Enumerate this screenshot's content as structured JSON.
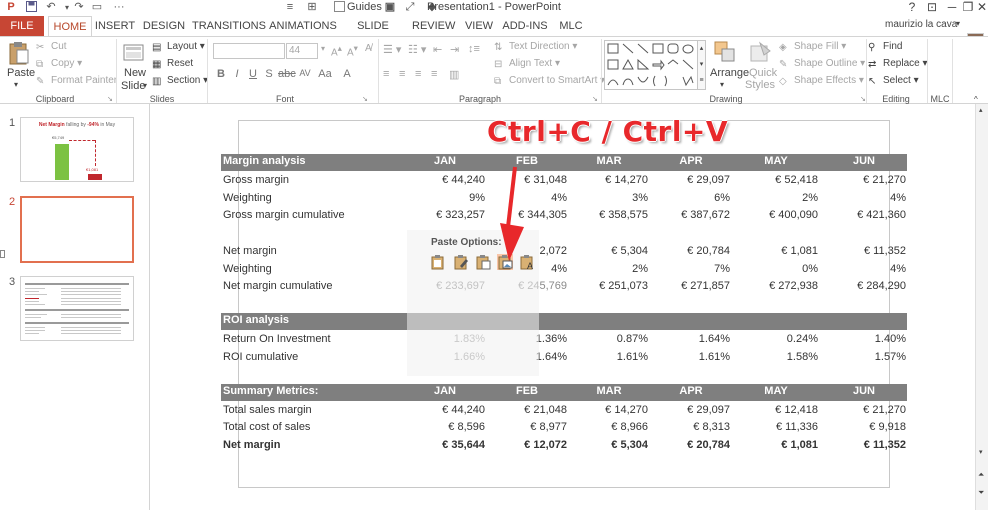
{
  "window": {
    "title": "Presentation1 - PowerPoint",
    "guides_label": "Guides",
    "user_name": "maurizio la cava",
    "help": "?",
    "ribbon_opts": "⊡",
    "minimize": "─",
    "restore": "❐",
    "close": "✕"
  },
  "tabs": [
    "FILE",
    "HOME",
    "INSERT",
    "DESIGN",
    "TRANSITIONS",
    "ANIMATIONS",
    "SLIDE SHOW",
    "REVIEW",
    "VIEW",
    "ADD-INS",
    "MLC"
  ],
  "ribbon": {
    "clipboard": {
      "paste": "Paste",
      "cut": "Cut",
      "copy": "Copy",
      "format_painter": "Format Painter",
      "label": "Clipboard"
    },
    "slides": {
      "new_slide_1": "New",
      "new_slide_2": "Slide",
      "layout": "Layout",
      "reset": "Reset",
      "section": "Section",
      "label": "Slides"
    },
    "font": {
      "size": "44",
      "label": "Font"
    },
    "paragraph": {
      "text_direction": "Text Direction",
      "align_text": "Align Text",
      "convert_smartart": "Convert to SmartArt",
      "label": "Paragraph"
    },
    "drawing": {
      "arrange": "Arrange",
      "quick_styles_1": "Quick",
      "quick_styles_2": "Styles",
      "shape_fill": "Shape Fill",
      "shape_outline": "Shape Outline",
      "shape_effects": "Shape Effects",
      "label": "Drawing"
    },
    "editing": {
      "find": "Find",
      "replace": "Replace",
      "select": "Select",
      "label": "Editing"
    },
    "mlc": {
      "label": "MLC"
    }
  },
  "thumbnails": {
    "numbers": [
      "1",
      "2",
      "3"
    ],
    "slide1_title_a": "Net Margin",
    "slide1_title_b": " falling by ",
    "slide1_title_c": "-94%",
    "slide1_title_d": " in May",
    "slide1_bar1_label": "€5,749",
    "slide1_bar2_label": "€1,081"
  },
  "slide": {
    "overlay_title": "Ctrl+C / Ctrl+V",
    "months": [
      "JAN",
      "FEB",
      "MAR",
      "APR",
      "MAY",
      "JUN"
    ],
    "margin_header": "Margin analysis",
    "margin_rows": [
      {
        "label": "Gross margin",
        "values": [
          "€ 44,240",
          "€ 31,048",
          "€ 14,270",
          "€ 29,097",
          "€ 52,418",
          "€ 21,270"
        ]
      },
      {
        "label": "Weighting",
        "values": [
          "9%",
          "4%",
          "3%",
          "6%",
          "2%",
          "4%"
        ]
      },
      {
        "label": "Gross margin cumulative",
        "values": [
          "€ 323,257",
          "€ 344,305",
          "€ 358,575",
          "€ 387,672",
          "€ 400,090",
          "€ 421,360"
        ]
      }
    ],
    "net_rows": [
      {
        "label": "Net margin",
        "values": [
          "",
          "2,072",
          "€ 5,304",
          "€ 20,784",
          "€ 1,081",
          "€ 11,352"
        ]
      },
      {
        "label": "Weighting",
        "values": [
          "",
          "4%",
          "2%",
          "7%",
          "0%",
          "4%"
        ]
      },
      {
        "label": "Net margin cumulative",
        "values": [
          "€ 233,697",
          "€ 245,769",
          "€ 251,073",
          "€ 271,857",
          "€ 272,938",
          "€ 284,290"
        ]
      }
    ],
    "roi_header": "ROI analysis",
    "roi_rows": [
      {
        "label": "Return On Investment",
        "values": [
          "1.83%",
          "1.36%",
          "0.87%",
          "1.64%",
          "0.24%",
          "1.40%"
        ]
      },
      {
        "label": "ROI cumulative",
        "values": [
          "1.66%",
          "1.64%",
          "1.61%",
          "1.61%",
          "1.58%",
          "1.57%"
        ]
      }
    ],
    "summary_header": "Summary Metrics:",
    "summary_rows": [
      {
        "label": "Total sales margin",
        "values": [
          "€ 44,240",
          "€ 21,048",
          "€ 14,270",
          "€ 29,097",
          "€ 12,418",
          "€ 21,270"
        ]
      },
      {
        "label": "Total cost of sales",
        "values": [
          "€ 8,596",
          "€ 8,977",
          "€ 8,966",
          "€ 8,313",
          "€ 11,336",
          "€ 9,918"
        ]
      },
      {
        "label": "Net margin",
        "values": [
          "€ 35,644",
          "€ 12,072",
          "€ 5,304",
          "€ 20,784",
          "€ 1,081",
          "€ 11,352"
        ]
      }
    ],
    "paste_options_label": "Paste Options:"
  },
  "colors": {
    "accent": "#c74634",
    "header_bg": "#7f7f7f",
    "red": "#e8282b",
    "thumb_green": "#7cc242",
    "thumb_red": "#c0272d"
  }
}
